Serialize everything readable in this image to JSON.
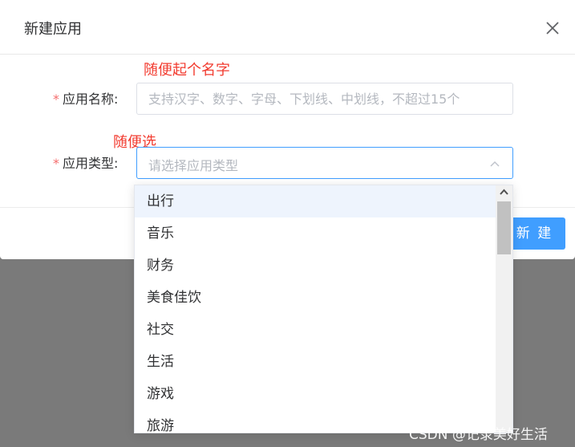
{
  "dialog": {
    "title": "新建应用",
    "close_icon": "close-icon",
    "create_button": "新 建"
  },
  "form": {
    "name_hint": "随便起个名字",
    "name_label": "应用名称:",
    "name_placeholder": "支持汉字、数字、字母、下划线、中划线，不超过15个",
    "type_hint": "随便选",
    "type_label": "应用类型:",
    "type_placeholder": "请选择应用类型",
    "required_mark": "*"
  },
  "dropdown": {
    "options": [
      "出行",
      "音乐",
      "财务",
      "美食佳饮",
      "社交",
      "生活",
      "游戏",
      "旅游"
    ]
  },
  "watermark": "CSDN @记录美好生活",
  "colors": {
    "primary": "#409eff",
    "annotation": "#f23b2f",
    "required": "#f56c6c",
    "overlay": "#7a7a7a"
  }
}
